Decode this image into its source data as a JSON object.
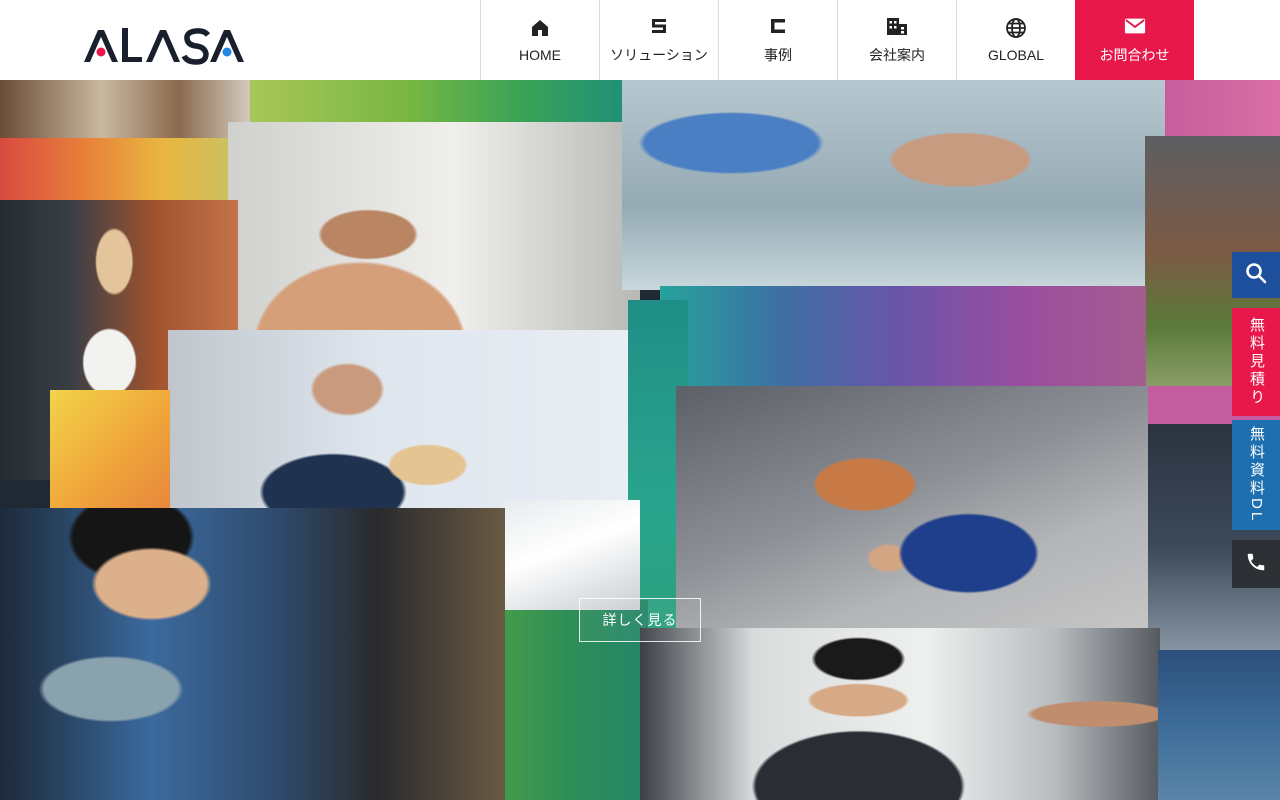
{
  "brand": {
    "logo_text": "ALASA",
    "accent_color": "#e8194a"
  },
  "nav": {
    "items": [
      {
        "label": "HOME",
        "icon": "home-icon"
      },
      {
        "label": "ソリューション",
        "icon": "solution-icon"
      },
      {
        "label": "事例",
        "icon": "cases-icon"
      },
      {
        "label": "会社案内",
        "icon": "building-icon"
      },
      {
        "label": "GLOBAL",
        "icon": "globe-icon"
      }
    ],
    "contact": {
      "label": "お問合わせ",
      "icon": "mail-icon"
    }
  },
  "hero": {
    "detail_label": "詳しく見る"
  },
  "side": {
    "search_icon": "search-icon",
    "quote_label": "無料見積り",
    "docs_label": "無料資料DL",
    "phone_icon": "phone-icon"
  }
}
